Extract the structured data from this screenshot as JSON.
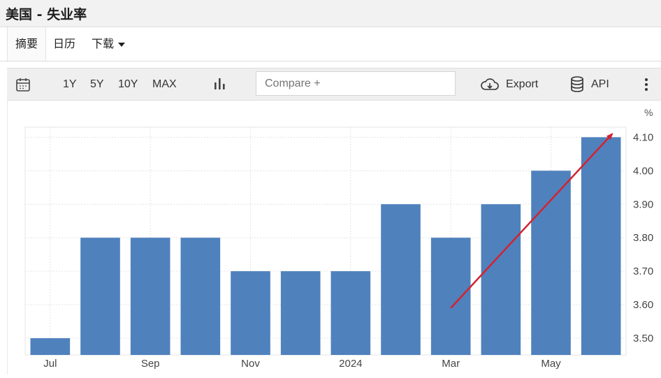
{
  "header": {
    "title": "美国 - 失业率"
  },
  "tabs": [
    {
      "label": "摘要"
    },
    {
      "label": "日历"
    },
    {
      "label": "下载"
    }
  ],
  "toolbar": {
    "ranges": [
      "1Y",
      "5Y",
      "10Y",
      "MAX"
    ],
    "compare_placeholder": "Compare +",
    "export_label": "Export",
    "api_label": "API"
  },
  "icons": [
    "calendar-icon",
    "bar-chart-icon",
    "cloud-download-icon",
    "database-icon",
    "more-vertical-icon"
  ],
  "chart_data": {
    "type": "bar",
    "unit_label": "%",
    "categories": [
      "Jul",
      "",
      "Sep",
      "",
      "Nov",
      "",
      "2024",
      "",
      "Mar",
      "",
      "May",
      ""
    ],
    "values": [
      3.5,
      3.8,
      3.8,
      3.8,
      3.7,
      3.7,
      3.7,
      3.9,
      3.8,
      3.9,
      4.0,
      4.1
    ],
    "yticks": [
      "3.50",
      "3.60",
      "3.70",
      "3.80",
      "3.90",
      "4.00",
      "4.10"
    ],
    "ylim": [
      3.45,
      4.13
    ],
    "bar_color": "#4f81bd",
    "annotation": {
      "type": "arrow",
      "color": "#d3232f",
      "direction": "up-right",
      "from_category_index": 8,
      "to_category_index": 11
    }
  }
}
